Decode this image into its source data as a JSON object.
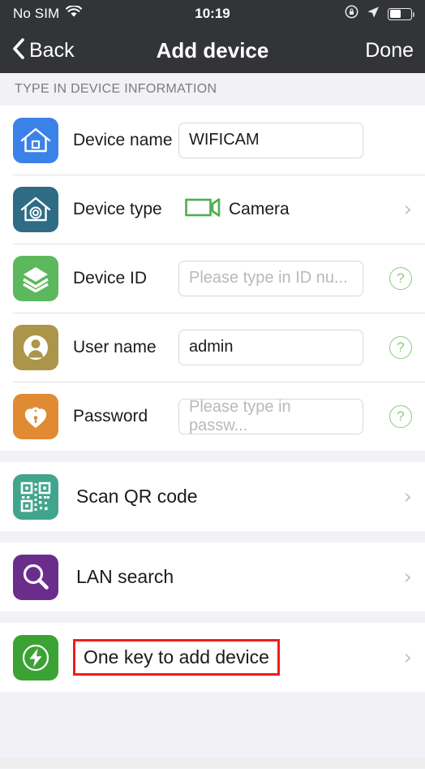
{
  "status_bar": {
    "carrier": "No SIM",
    "wifi_icon": "wifi-icon",
    "time": "10:19",
    "rotation_lock_icon": "rotation-lock-icon",
    "location_icon": "location-arrow-icon",
    "battery_icon": "battery-icon",
    "battery_level": 55
  },
  "nav_bar": {
    "back_label": "Back",
    "back_icon": "chevron-left-icon",
    "title": "Add device",
    "done_label": "Done"
  },
  "section": {
    "header": "TYPE IN DEVICE INFORMATION"
  },
  "form": {
    "rows": [
      {
        "label": "Device name",
        "icon": "house-icon",
        "icon_color": "#3b82e8",
        "value": "WIFICAM",
        "placeholder": "",
        "has_help": false,
        "has_chevron": false
      },
      {
        "label": "Device type",
        "icon": "house-camera-icon",
        "icon_color": "#2e6c85",
        "value": "Camera",
        "value_icon": "camcorder-icon",
        "value_icon_color": "#4caf50",
        "has_help": false,
        "has_chevron": true
      },
      {
        "label": "Device ID",
        "icon": "layers-icon",
        "icon_color": "#5cb85c",
        "value": "",
        "placeholder": "Please type in ID nu...",
        "has_help": true,
        "has_chevron": false
      },
      {
        "label": "User name",
        "icon": "person-icon",
        "icon_color": "#ab9549",
        "value": "admin",
        "placeholder": "",
        "has_help": true,
        "has_chevron": false
      },
      {
        "label": "Password",
        "icon": "heart-lock-icon",
        "icon_color": "#e08a33",
        "value": "",
        "placeholder": "Please type in passw...",
        "has_help": true,
        "has_chevron": false
      }
    ],
    "help_glyph": "?"
  },
  "actions": [
    {
      "label": "Scan QR code",
      "icon": "qr-code-icon",
      "icon_color": "#41a58d",
      "highlighted": false
    },
    {
      "label": "LAN search",
      "icon": "magnifier-icon",
      "icon_color": "#6b2d8c",
      "highlighted": false
    },
    {
      "label": "One key to add device",
      "icon": "lightning-bolt-icon",
      "icon_color": "#3ba334",
      "highlighted": true,
      "highlight_color": "#f41b1b"
    }
  ],
  "chevron_glyph": "›"
}
